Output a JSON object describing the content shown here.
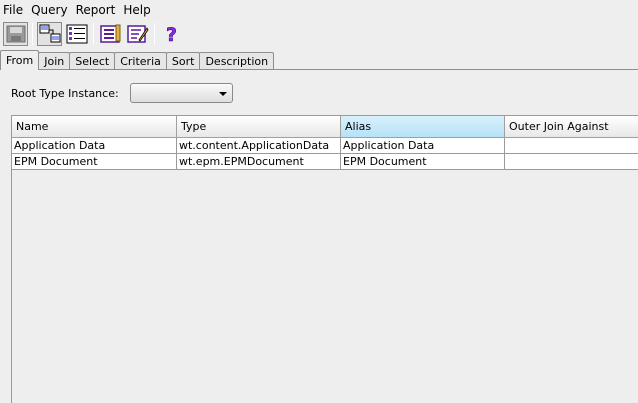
{
  "menu": {
    "file": "File",
    "query": "Query",
    "report": "Report",
    "help": "Help"
  },
  "toolbar": {
    "buttons": [
      {
        "icon": "save-icon"
      },
      {
        "icon": "from-join-icon"
      },
      {
        "icon": "select-list-icon"
      },
      {
        "icon": "report-list-icon"
      },
      {
        "icon": "edit-report-icon"
      },
      {
        "icon": "help-icon"
      }
    ]
  },
  "tabs": [
    "From",
    "Join",
    "Select",
    "Criteria",
    "Sort",
    "Description"
  ],
  "root_type": {
    "label": "Root Type Instance:",
    "value": ""
  },
  "table": {
    "columns": [
      "Name",
      "Type",
      "Alias",
      "Outer Join Against"
    ],
    "rows": [
      [
        "Application Data",
        "wt.content.ApplicationData",
        "Application Data",
        ""
      ],
      [
        "EPM Document",
        "wt.epm.EPMDocument",
        "EPM Document",
        ""
      ]
    ]
  },
  "colors": {
    "selected_header": "#b6e2f7",
    "help_purple": "#8a2be2"
  }
}
